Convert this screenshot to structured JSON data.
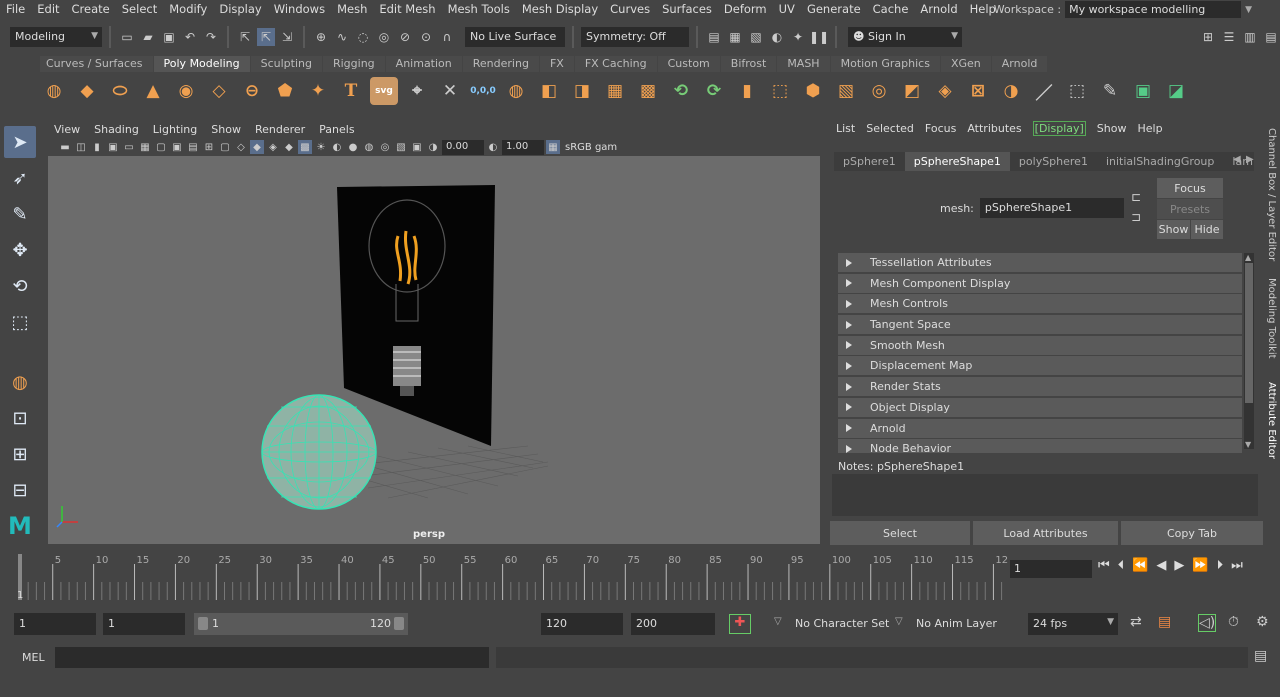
{
  "menubar": {
    "items": [
      "File",
      "Edit",
      "Create",
      "Select",
      "Modify",
      "Display",
      "Windows",
      "Mesh",
      "Edit Mesh",
      "Mesh Tools",
      "Mesh Display",
      "Curves",
      "Surfaces",
      "Deform",
      "UV",
      "Generate",
      "Cache",
      "Arnold",
      "Help"
    ],
    "workspace_label": "Workspace :",
    "workspace_value": "My workspace modelling"
  },
  "toolbar": {
    "mode": "Modeling",
    "live_surface": "No Live Surface",
    "symmetry": "Symmetry: Off",
    "sign_in": "Sign In"
  },
  "shelf": {
    "tabs": [
      "Curves / Surfaces",
      "Poly Modeling",
      "Sculpting",
      "Rigging",
      "Animation",
      "Rendering",
      "FX",
      "FX Caching",
      "Custom",
      "Bifrost",
      "MASH",
      "Motion Graphics",
      "XGen",
      "Arnold"
    ],
    "active": "Poly Modeling"
  },
  "viewport": {
    "menu": [
      "View",
      "Shading",
      "Lighting",
      "Show",
      "Renderer",
      "Panels"
    ],
    "field1": "0.00",
    "field2": "1.00",
    "colorspace": "sRGB gam",
    "camera": "persp"
  },
  "attr_editor": {
    "menu": [
      "List",
      "Selected",
      "Focus",
      "Attributes",
      "[Display]",
      "Show",
      "Help"
    ],
    "tabs": [
      "pSphere1",
      "pSphereShape1",
      "polySphere1",
      "initialShadingGroup",
      "lam"
    ],
    "active_tab": "pSphereShape1",
    "mesh_label": "mesh:",
    "mesh_value": "pSphereShape1",
    "focus": "Focus",
    "presets": "Presets",
    "show": "Show",
    "hide": "Hide",
    "sections": [
      "Tessellation Attributes",
      "Mesh Component Display",
      "Mesh Controls",
      "Tangent Space",
      "Smooth Mesh",
      "Displacement Map",
      "Render Stats",
      "Object Display",
      "Arnold",
      "Node Behavior"
    ],
    "notes": "Notes:  pSphereShape1",
    "buttons": [
      "Select",
      "Load Attributes",
      "Copy Tab"
    ]
  },
  "side_tabs": [
    "Channel Box / Layer Editor",
    "Modeling Toolkit",
    "Attribute Editor"
  ],
  "timeline": {
    "ticks": [
      "5",
      "10",
      "15",
      "20",
      "25",
      "30",
      "35",
      "40",
      "45",
      "50",
      "55",
      "60",
      "65",
      "70",
      "75",
      "80",
      "85",
      "90",
      "95",
      "100",
      "105",
      "110",
      "115",
      "12"
    ],
    "start_label": "1",
    "current_frame": "1"
  },
  "range": {
    "start": "1",
    "inner_start": "1",
    "slider_start": "1",
    "slider_end": "120",
    "end": "120",
    "total": "200",
    "char_set": "No Character Set",
    "anim_layer": "No Anim Layer",
    "fps": "24 fps"
  },
  "mel": {
    "label": "MEL"
  }
}
